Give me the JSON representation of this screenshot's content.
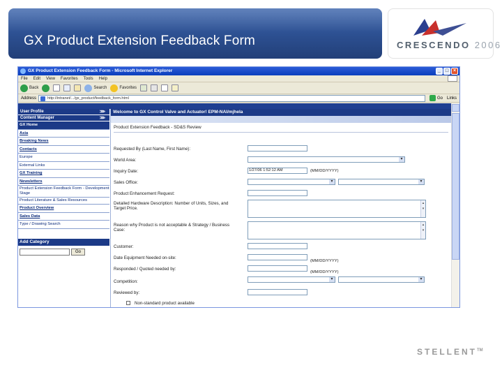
{
  "slide": {
    "title": "GX Product Extension Feedback Form",
    "logo": {
      "name": "CRESCENDO",
      "year": "2006"
    },
    "footer_logo": "STELLENT",
    "footer_tm": "TM"
  },
  "browser": {
    "window_title": "GX Product Extension Feedback Form - Microsoft Internet Explorer",
    "menu": [
      "File",
      "Edit",
      "View",
      "Favorites",
      "Tools",
      "Help"
    ],
    "toolbar": {
      "back": "Back",
      "search": "Search",
      "favorites": "Favorites"
    },
    "address_label": "Address",
    "address_value": "http://intranet/.../gx_product/feedback_form.html",
    "go_label": "Go",
    "links_label": "Links"
  },
  "sidebar": {
    "user_profile": "User Profile",
    "content_manager": "Content Manager",
    "items": [
      {
        "label": "GX Home",
        "style": "dark"
      },
      {
        "label": "Asia",
        "style": "under"
      },
      {
        "label": "Breaking News",
        "style": "under"
      },
      {
        "label": "Contacts",
        "style": "under"
      },
      {
        "label": "Europe",
        "style": "plain"
      },
      {
        "label": "External Links",
        "style": "plain"
      },
      {
        "label": "GX Training",
        "style": "under"
      },
      {
        "label": "Newsletters",
        "style": "under"
      },
      {
        "label": "Product Extension Feedback Form - Development Stage",
        "style": "two"
      },
      {
        "label": "Product Literature & Sales Resources",
        "style": "two"
      },
      {
        "label": "Product Overview",
        "style": "under"
      },
      {
        "label": "Sales Data",
        "style": "under"
      },
      {
        "label": "Type / Drawing Search",
        "style": "plain"
      }
    ],
    "add_category": "Add Category",
    "go_label": "Go"
  },
  "main": {
    "welcome": "Welcome to GX Control Valve and Actuator! EPM-NAI/mjhela",
    "form_title": "Product Extension Feedback - SD&S Review",
    "fields": {
      "requested_by": "Requested By (Last Name, First Name):",
      "world_area": "World Area:",
      "inquiry_date": "Inquiry Date:",
      "inquiry_date_value": "1/27/06 1:52:12 AM",
      "date_format": "(MM/DD/YYYY)",
      "sales_office": "Sales Office:",
      "product_enhancement": "Product Enhancement Request:",
      "detailed_description": "Detailed Hardware Description: Number of Units, Sizes, and Target Price.",
      "reason": "Reason why Product is not acceptable & Strategy / Business Case:",
      "customer": "Customer:",
      "date_needed": "Date Equipment Needed on-site:",
      "responded": "Responded / Quoted needed by:",
      "competition": "Competition:",
      "reviewed_by": "Reviewed by:",
      "non_standard": "Non-standard product available"
    }
  }
}
